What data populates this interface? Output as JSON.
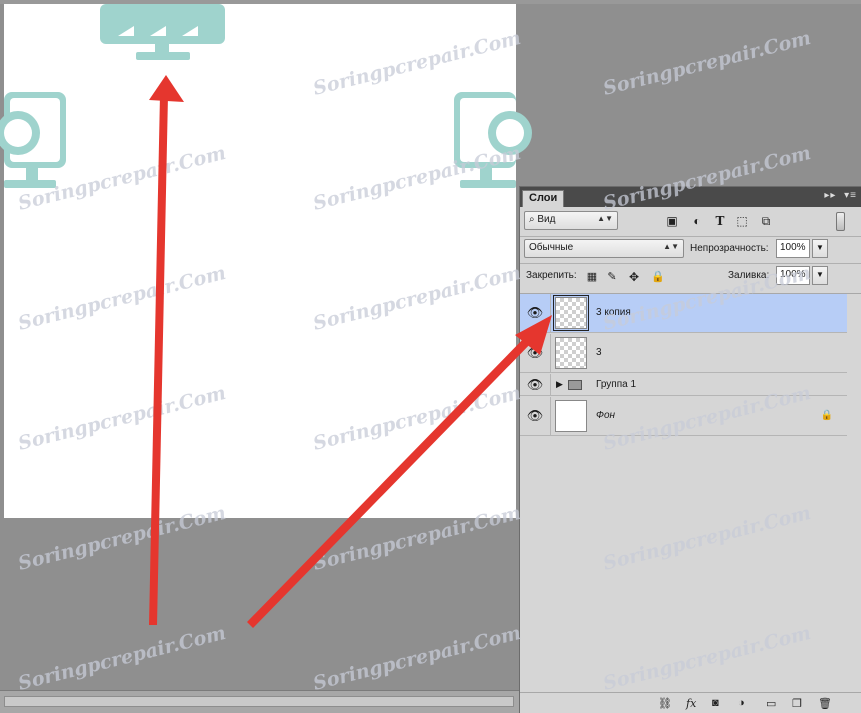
{
  "workspace": {
    "watermark": "Soringpcrepair.Com"
  },
  "layers_panel": {
    "tab_label": "Слои",
    "header_icons": {
      "collapse": "▸▸",
      "menu": "▾≡"
    },
    "filter": {
      "kind_label": "Вид",
      "search_icon": "⌕"
    },
    "filter_icons": [
      "image-filter-icon",
      "adjustment-filter-icon",
      "type-filter-icon",
      "shape-filter-icon",
      "smart-object-filter-icon"
    ],
    "blend_mode": "Обычные",
    "opacity_label": "Непрозрачность:",
    "opacity_value": "100%",
    "lock_label": "Закрепить:",
    "fill_label": "Заливка:",
    "fill_value": "100%",
    "layers": [
      {
        "name": "3 копия",
        "selected": true,
        "visible": true
      },
      {
        "name": "3",
        "selected": false,
        "visible": true
      },
      {
        "name": "Группа 1",
        "type": "group",
        "visible": true
      },
      {
        "name": "Фон",
        "locked": true,
        "visible": true
      }
    ],
    "footer_icons": [
      "link-layers-icon",
      "fx-icon",
      "mask-icon",
      "adjustment-icon",
      "new-group-icon",
      "new-layer-icon",
      "delete-icon"
    ],
    "footer_fx": "fx"
  },
  "colors": {
    "accent_teal": "#9fd3cd",
    "arrow_red": "#e5362e",
    "selected_layer": "#b7cdf6"
  }
}
